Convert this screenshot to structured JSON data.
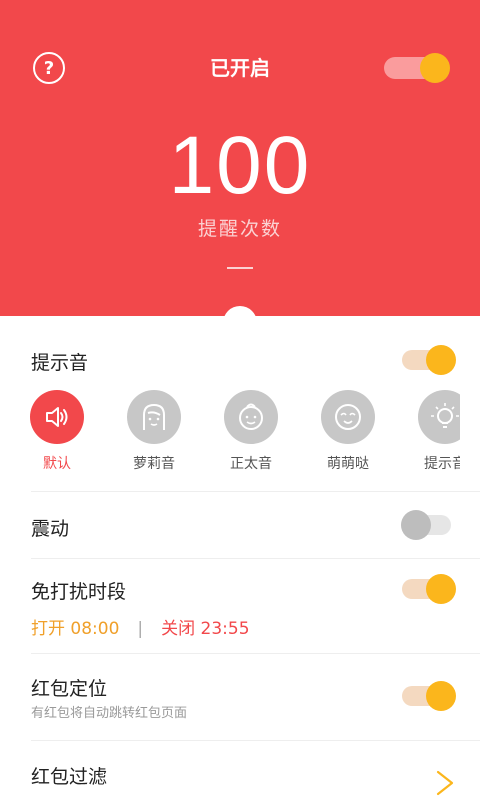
{
  "header": {
    "title": "已开启",
    "count": "100",
    "count_label": "提醒次数",
    "toggle_on": true
  },
  "sound": {
    "label": "提示音",
    "toggle_on": true,
    "items": [
      {
        "label": "默认",
        "icon": "speaker-icon",
        "selected": true
      },
      {
        "label": "萝莉音",
        "icon": "girl-face-icon",
        "selected": false
      },
      {
        "label": "正太音",
        "icon": "boy-face-icon",
        "selected": false
      },
      {
        "label": "萌萌哒",
        "icon": "cute-face-icon",
        "selected": false
      },
      {
        "label": "提示音",
        "icon": "lightbulb-icon",
        "selected": false
      }
    ]
  },
  "vibrate": {
    "label": "震动",
    "toggle_on": false
  },
  "quiet_hours": {
    "label": "免打扰时段",
    "toggle_on": true,
    "open": "打开 08:00",
    "separator": "|",
    "close": "关闭 23:55"
  },
  "locate": {
    "label": "红包定位",
    "subtext": "有红包将自动跳转红包页面",
    "toggle_on": true
  },
  "filter": {
    "label": "红包过滤"
  },
  "colors": {
    "header_bg": "#f2484b",
    "toggle_knob": "#fbb61c",
    "quiet_open": "#f0a02a",
    "quiet_close": "#f2484b"
  }
}
